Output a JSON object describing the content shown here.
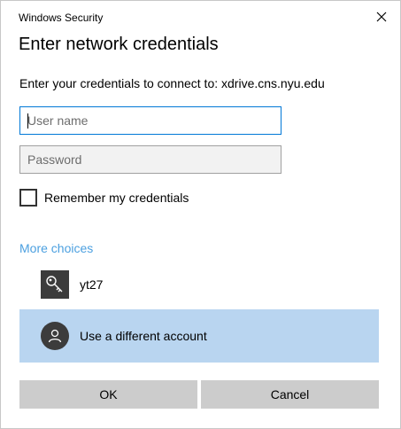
{
  "window": {
    "title": "Windows Security",
    "close_icon": "close-icon"
  },
  "dialog": {
    "heading": "Enter network credentials",
    "subtext": "Enter your credentials to connect to: xdrive.cns.nyu.edu"
  },
  "form": {
    "username": {
      "value": "",
      "placeholder": "User name"
    },
    "password": {
      "value": "",
      "placeholder": "Password"
    },
    "remember": {
      "label": "Remember my credentials",
      "checked": false
    }
  },
  "choices": {
    "header": "More choices",
    "accounts": [
      {
        "label": "yt27",
        "icon": "key-icon"
      },
      {
        "label": "Use a different account",
        "icon": "person-icon",
        "selected": true
      }
    ]
  },
  "buttons": {
    "ok": "OK",
    "cancel": "Cancel"
  },
  "colors": {
    "accent": "#0078d7",
    "link": "#4ca0e0",
    "selected_bg": "#b9d5f0",
    "button_bg": "#cccccc",
    "tile_bg": "#3c3c3c"
  }
}
